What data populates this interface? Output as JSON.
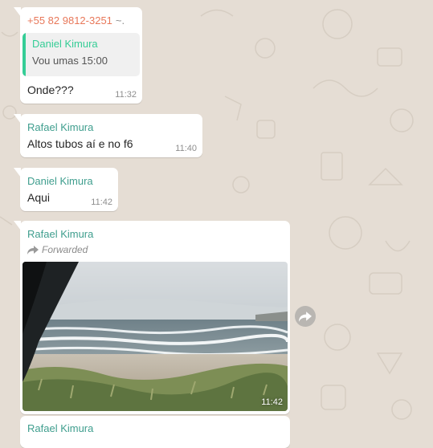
{
  "colors": {
    "background": "#e5ddd4",
    "bubble": "#ffffff",
    "sender_teal": "#3f9e8e",
    "sender_orange": "#e8785a",
    "quote_green": "#35cd96"
  },
  "messages": [
    {
      "sender": "+55 82 9812-3251",
      "sender_suffix": "~.",
      "quote": {
        "sender": "Daniel Kimura",
        "text": "Vou umas 15:00"
      },
      "text": "Onde???",
      "time": "11:32"
    },
    {
      "sender": "Rafael Kimura",
      "text": "Altos tubos aí e no f6",
      "time": "11:40"
    },
    {
      "sender": "Daniel Kimura",
      "text": "Aqui",
      "time": "11:42"
    },
    {
      "sender": "Rafael Kimura",
      "forwarded_label": "Forwarded",
      "media": "beach-photo",
      "time": "11:42"
    },
    {
      "sender": "Rafael Kimura"
    }
  ],
  "icons": {
    "forward": "forward-arrow-icon",
    "share": "share-arrow-icon"
  }
}
